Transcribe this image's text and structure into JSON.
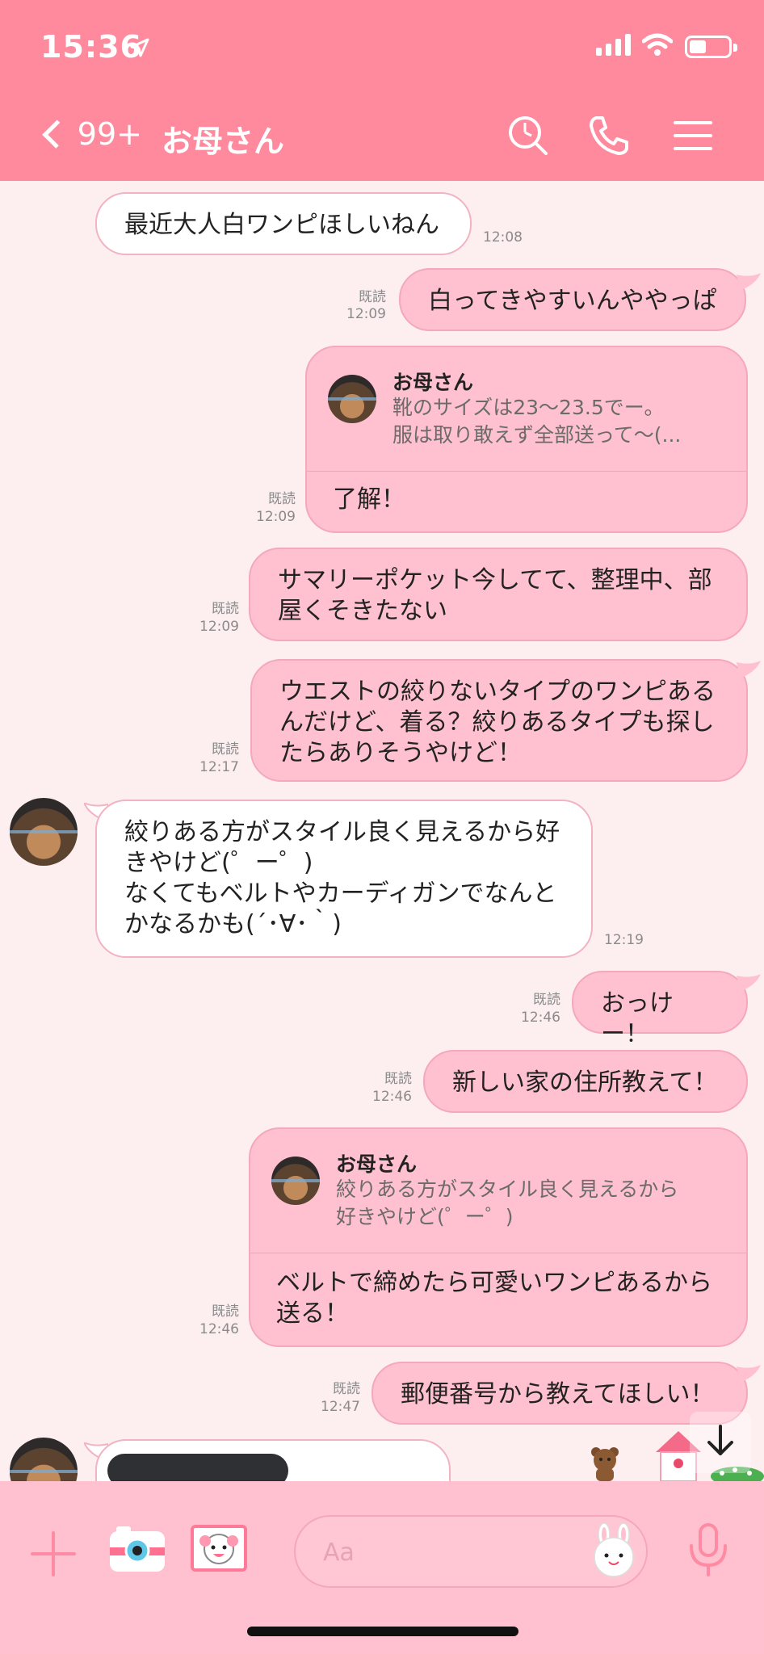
{
  "status_bar": {
    "time": "15:36"
  },
  "nav": {
    "back_count": "99+",
    "title": "お母さん"
  },
  "colors": {
    "header": "#ff8a9e",
    "background": "#fdeef0",
    "outgoing": "#ffc0cf",
    "incoming": "#ffffff"
  },
  "messages": [
    {
      "dir": "in",
      "text": "最近大人白ワンピほしいねん",
      "time": "12:08"
    },
    {
      "dir": "out",
      "text": "白ってきやすいんややっぱ",
      "read": "既読",
      "time": "12:09"
    },
    {
      "dir": "out",
      "quote_name": "お母さん",
      "quote_text": "靴のサイズは23〜23.5でー。\n服は取り敢えず全部送って〜(...",
      "text": "了解！",
      "read": "既読",
      "time": "12:09"
    },
    {
      "dir": "out",
      "text": "サマリーポケット今してて、整理中、部\n屋くそきたない",
      "read": "既読",
      "time": "12:09"
    },
    {
      "dir": "out",
      "text": "ウエストの絞りないタイプのワンピある\nんだけど、着る？絞りあるタイプも探し\nたらありそうやけど！",
      "read": "既読",
      "time": "12:17"
    },
    {
      "dir": "in",
      "text": "絞りある方がスタイル良く見えるから好\nきやけど(゜ー゜)\nなくてもベルトやカーディガンでなんと\nかなるかも(´･∀･｀)",
      "time": "12:19"
    },
    {
      "dir": "out",
      "text": "おっけー！",
      "read": "既読",
      "time": "12:46"
    },
    {
      "dir": "out",
      "text": "新しい家の住所教えて！",
      "read": "既読",
      "time": "12:46"
    },
    {
      "dir": "out",
      "quote_name": "お母さん",
      "quote_text": "絞りある方がスタイル良く見えるから\n好きやけど(゜ー゜)",
      "text": "ベルトで締めたら可愛いワンピあるから\n送る！",
      "read": "既読",
      "time": "12:46"
    },
    {
      "dir": "out",
      "text": "郵便番号から教えてほしい！",
      "read": "既読",
      "time": "12:47"
    }
  ],
  "input": {
    "placeholder": "Aa"
  },
  "icons": {
    "back": "chevron-left-icon",
    "search": "search-icon",
    "call": "phone-icon",
    "menu": "hamburger-menu-icon",
    "add": "plus-icon",
    "camera": "camera-icon",
    "photo": "photo-icon",
    "sticker": "sticker-icon",
    "mic": "microphone-icon",
    "scroll": "arrow-down-icon"
  }
}
